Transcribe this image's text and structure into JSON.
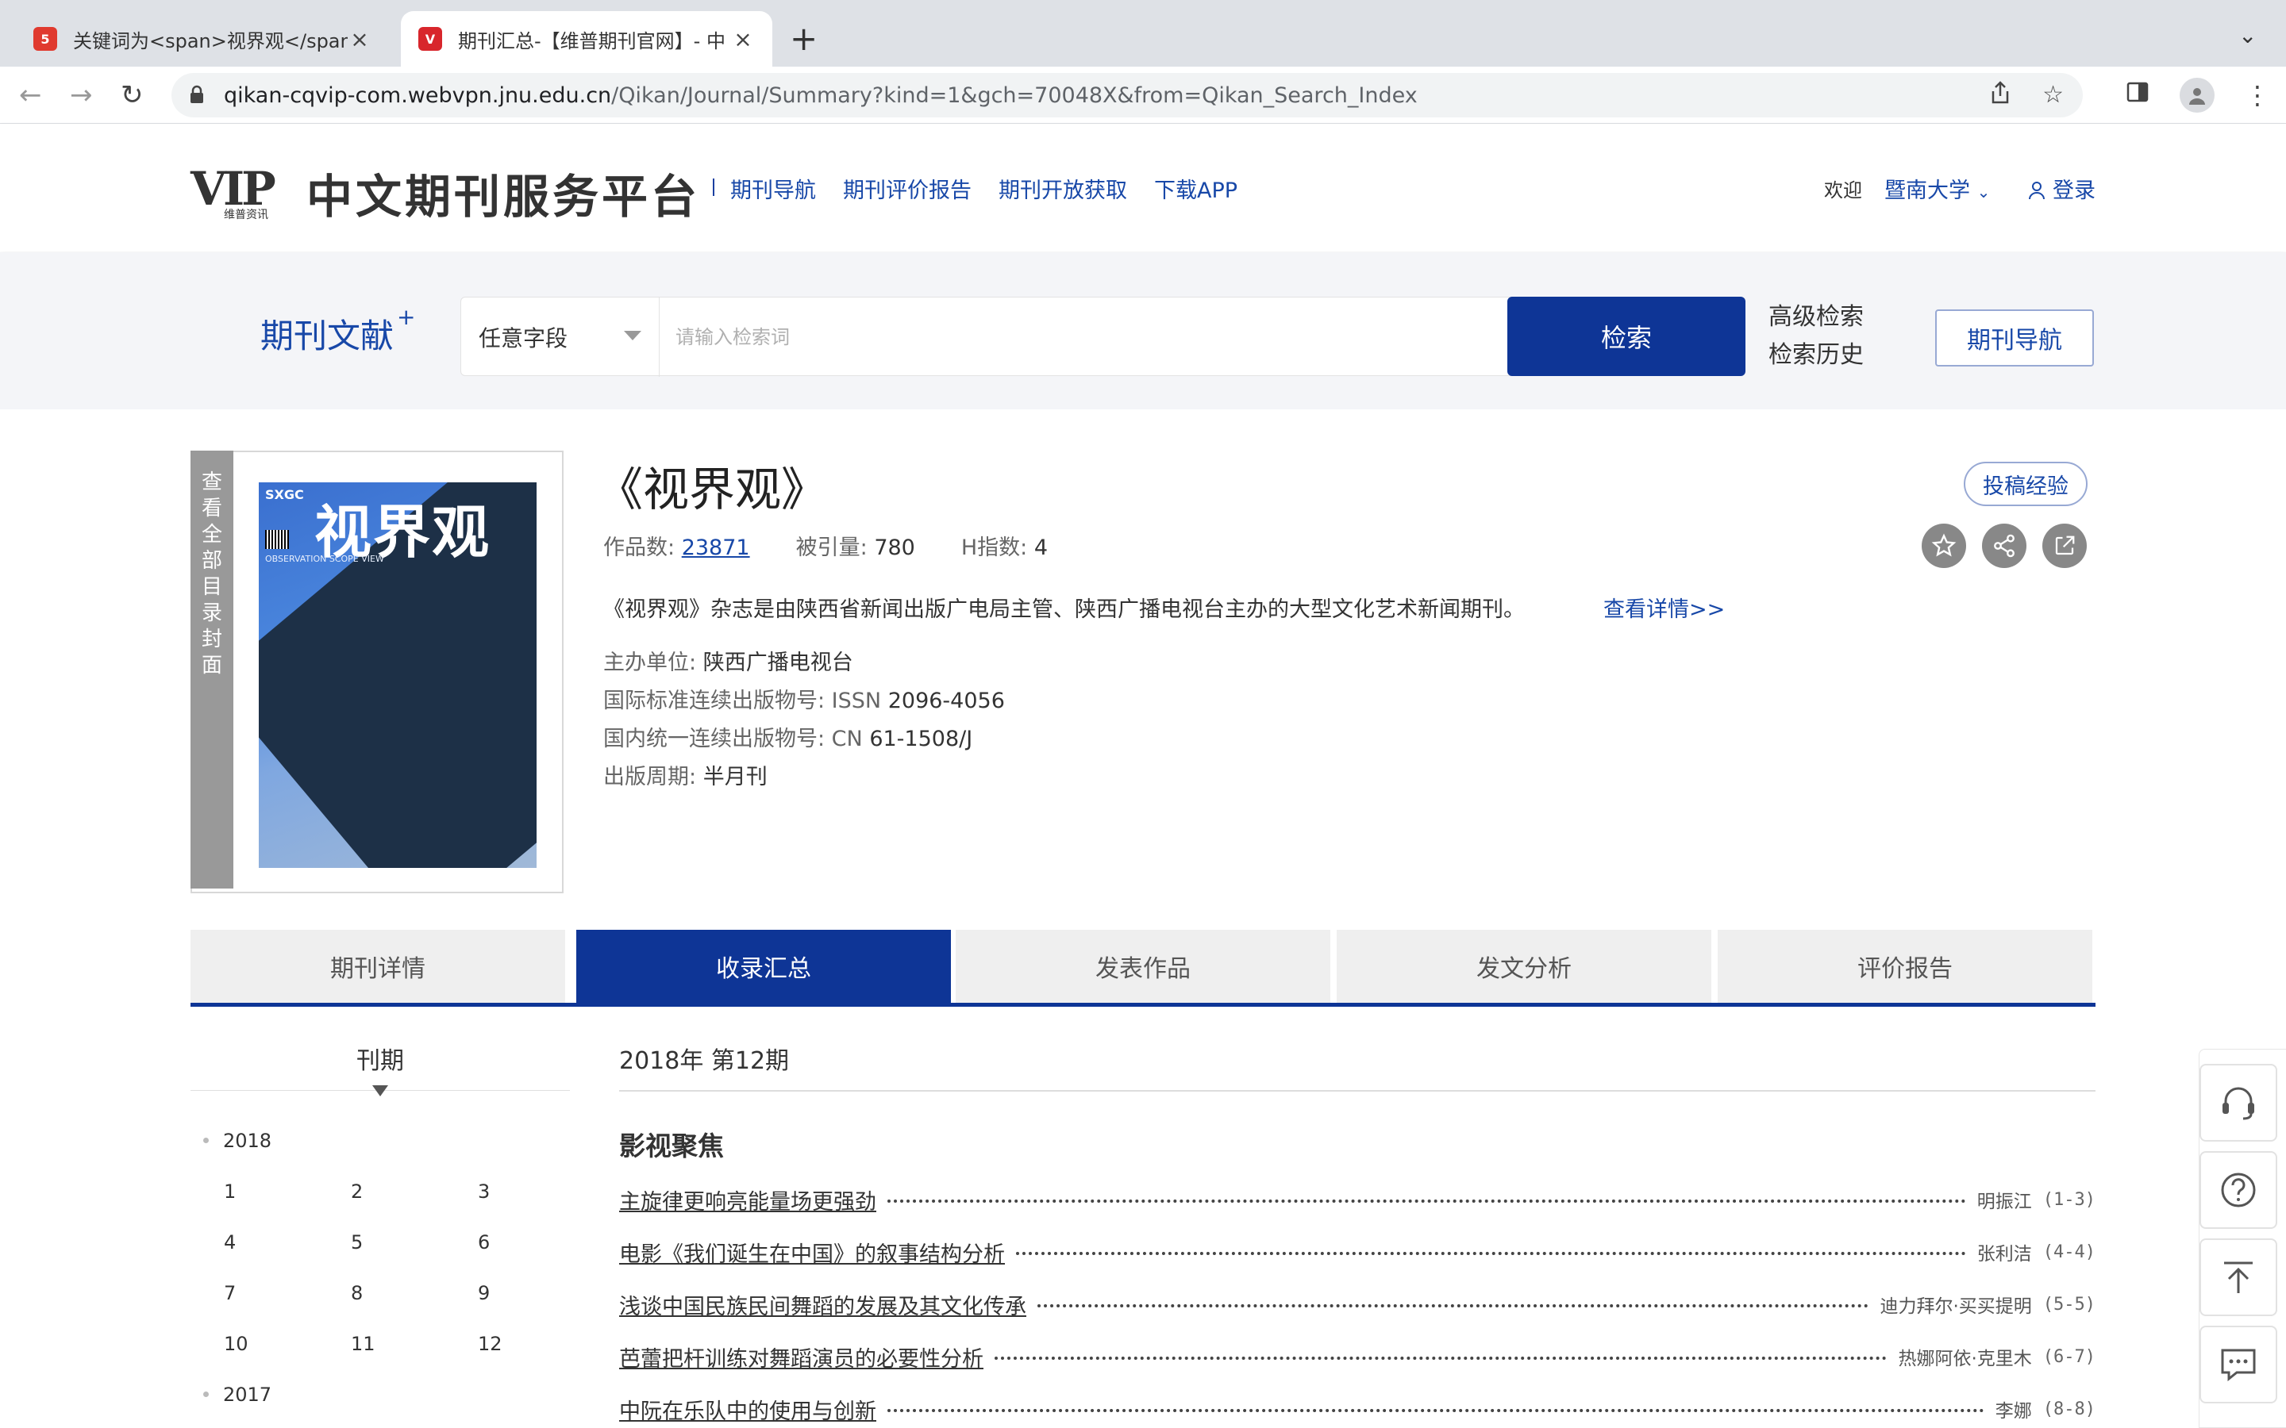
{
  "browser": {
    "tabs": [
      {
        "title": "关键词为<span>视界观</span>",
        "active": false
      },
      {
        "title": "期刊汇总-【维普期刊官网】- 中",
        "active": true
      }
    ],
    "url_host": "qikan-cqvip-com.webvpn.jnu.edu.cn",
    "url_path": "/Qikan/Journal/Summary?kind=1&gch=70048X&from=Qikan_Search_Index"
  },
  "header": {
    "logo_text": "VIP",
    "logo_sub": "维普资讯",
    "site_name": "中文期刊服务平台",
    "nav": [
      "期刊导航",
      "期刊评价报告",
      "期刊开放获取",
      "下载APP"
    ],
    "welcome": "欢迎",
    "institution": "暨南大学",
    "login": "登录"
  },
  "search": {
    "label": "期刊文献",
    "label_sup": "+",
    "field": "任意字段",
    "placeholder": "请输入检索词",
    "button": "检索",
    "advanced": "高级检索",
    "history": "检索历史",
    "journal_nav": "期刊导航"
  },
  "journal": {
    "cover_side_text": "查看全部目录封面",
    "cover_title": "视界观",
    "cover_brand": "SXGC",
    "cover_subtitle": "OBSERVATION SCOPE VIEW",
    "title": "《视界观》",
    "works_label": "作品数:",
    "works_value": "23871",
    "cited_label": "被引量:",
    "cited_value": "780",
    "h_label": "H指数:",
    "h_value": "4",
    "description": "《视界观》杂志是由陕西省新闻出版广电局主管、陕西广播电视台主办的大型文化艺术新闻期刊。",
    "more": "查看详情>>",
    "sponsor_label": "主办单位:",
    "sponsor": "陕西广播电视台",
    "issn_label": "国际标准连续出版物号: ISSN",
    "issn": "2096-4056",
    "cn_label": "国内统一连续出版物号: CN",
    "cn": "61-1508/J",
    "period_label": "出版周期:",
    "period": "半月刊",
    "submit_exp": "投稿经验"
  },
  "tabs": [
    "期刊详情",
    "收录汇总",
    "发表作品",
    "发文分析",
    "评价报告"
  ],
  "active_tab": "收录汇总",
  "issues": {
    "heading": "刊期",
    "years": [
      {
        "year": "2018",
        "numbers": [
          "1",
          "2",
          "3",
          "4",
          "5",
          "6",
          "7",
          "8",
          "9",
          "10",
          "11",
          "12"
        ]
      },
      {
        "year": "2017",
        "numbers": []
      }
    ]
  },
  "contents": {
    "issue_title": "2018年 第12期",
    "section": "影视聚焦",
    "articles": [
      {
        "title": "主旋律更响亮能量场更强劲",
        "author": "明振江",
        "pages": "(1-3)"
      },
      {
        "title": "电影《我们诞生在中国》的叙事结构分析",
        "author": "张利洁",
        "pages": "(4-4)"
      },
      {
        "title": "浅谈中国民族民间舞蹈的发展及其文化传承",
        "author": "迪力拜尔·买买提明",
        "pages": "(5-5)"
      },
      {
        "title": "芭蕾把杆训练对舞蹈演员的必要性分析",
        "author": "热娜阿依·克里木",
        "pages": "(6-7)"
      },
      {
        "title": "中阮在乐队中的使用与创新",
        "author": "李娜",
        "pages": "(8-8)"
      }
    ]
  },
  "colors": {
    "primary": "#0e3596",
    "link": "#1848a8",
    "logo_red": "#c9232a"
  }
}
